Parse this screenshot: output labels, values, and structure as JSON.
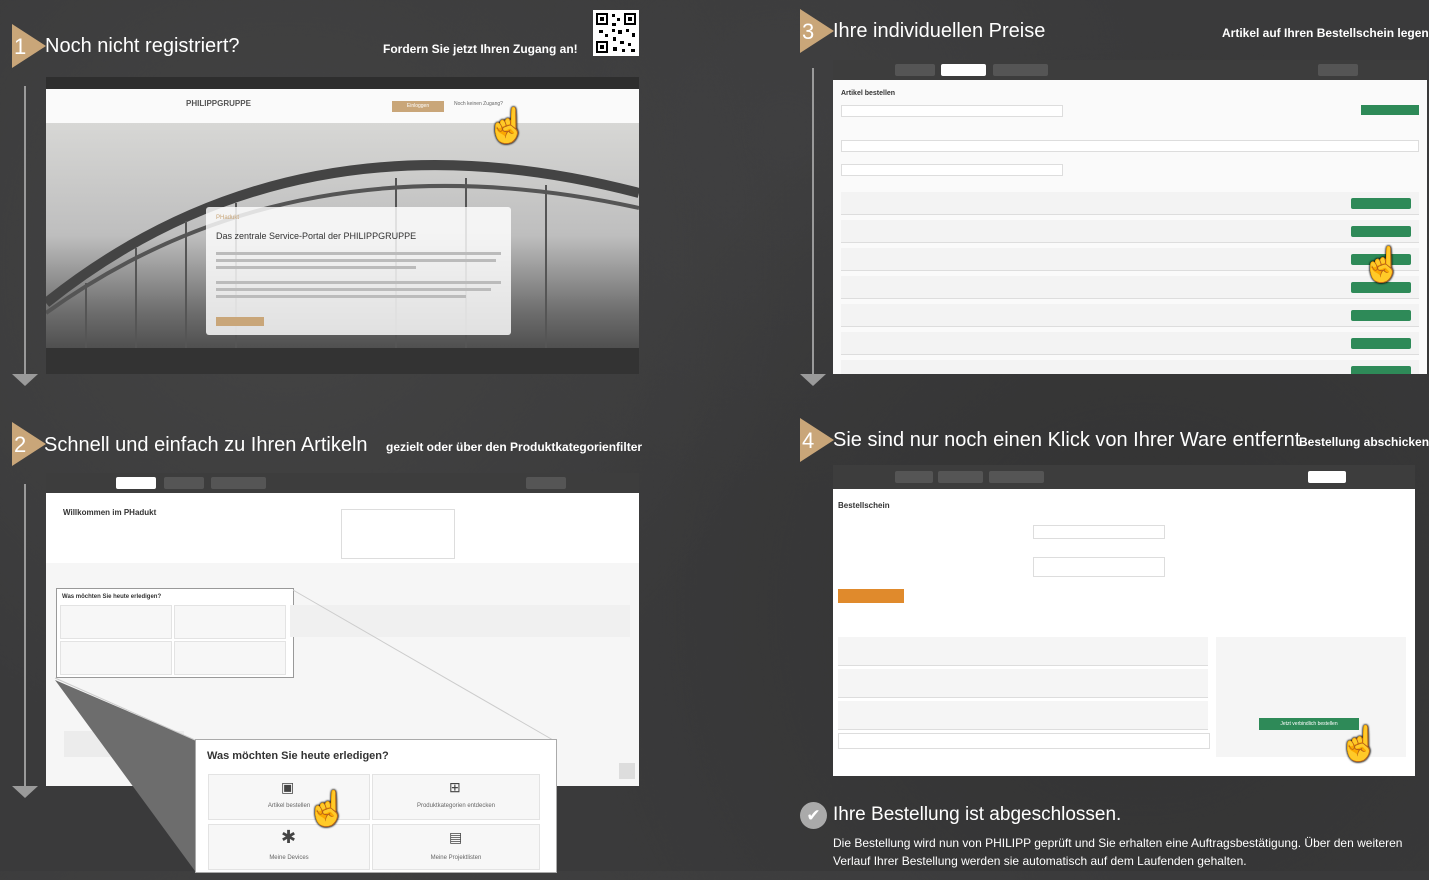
{
  "steps": [
    {
      "number": "1",
      "title": "Noch nicht registriert?",
      "subtitle": "Fordern Sie jetzt Ihren Zugang an!"
    },
    {
      "number": "2",
      "title": "Schnell und einfach zu Ihren Artikeln",
      "subtitle": "gezielt oder über den Produktkategorienfilter"
    },
    {
      "number": "3",
      "title": "Ihre individuellen Preise",
      "subtitle": "Artikel auf Ihren Bestellschein legen"
    },
    {
      "number": "4",
      "title": "Sie sind nur noch einen Klick von Ihrer Ware entfernt",
      "subtitle": "Bestellung abschicken"
    }
  ],
  "final": {
    "title": "Ihre Bestellung ist abgeschlossen.",
    "text": "Die Bestellung wird nun von PHILIPP geprüft und Sie erhalten eine Auftragsbestätigung. Über den weiteren Verlauf Ihrer Bestellung werden sie automatisch auf dem Laufenden gehalten."
  },
  "shot1": {
    "logo": "PHILIPPGRUPPE",
    "card_kicker": "PHadukt",
    "card_title": "Das zentrale Service-Portal der PHILIPPGRUPPE",
    "login_label": "Einloggen",
    "register_label": "Noch keinen Zugang?"
  },
  "shot2": {
    "welcome": "Willkommen im PHadukt",
    "question": "Was möchten Sie heute erledigen?",
    "question_small": "Was möchten Sie heute erledigen?",
    "tiles": [
      "Artikel bestellen",
      "Produktkategorien entdecken",
      "Meine Devices",
      "Meine Projektlisten"
    ]
  },
  "shot3": {
    "heading": "Artikel bestellen"
  },
  "shot4": {
    "heading": "Bestellschein",
    "button": "Jetzt verbindlich bestellen"
  },
  "icons": {
    "step_marker": "triangle-marker-icon",
    "cursor": "hand-pointer-icon",
    "check": "check-circle-icon",
    "qr": "qr-code-icon"
  },
  "colors": {
    "accent": "#c9a679",
    "green": "#2e8a58",
    "background": "#3a3a3b"
  }
}
